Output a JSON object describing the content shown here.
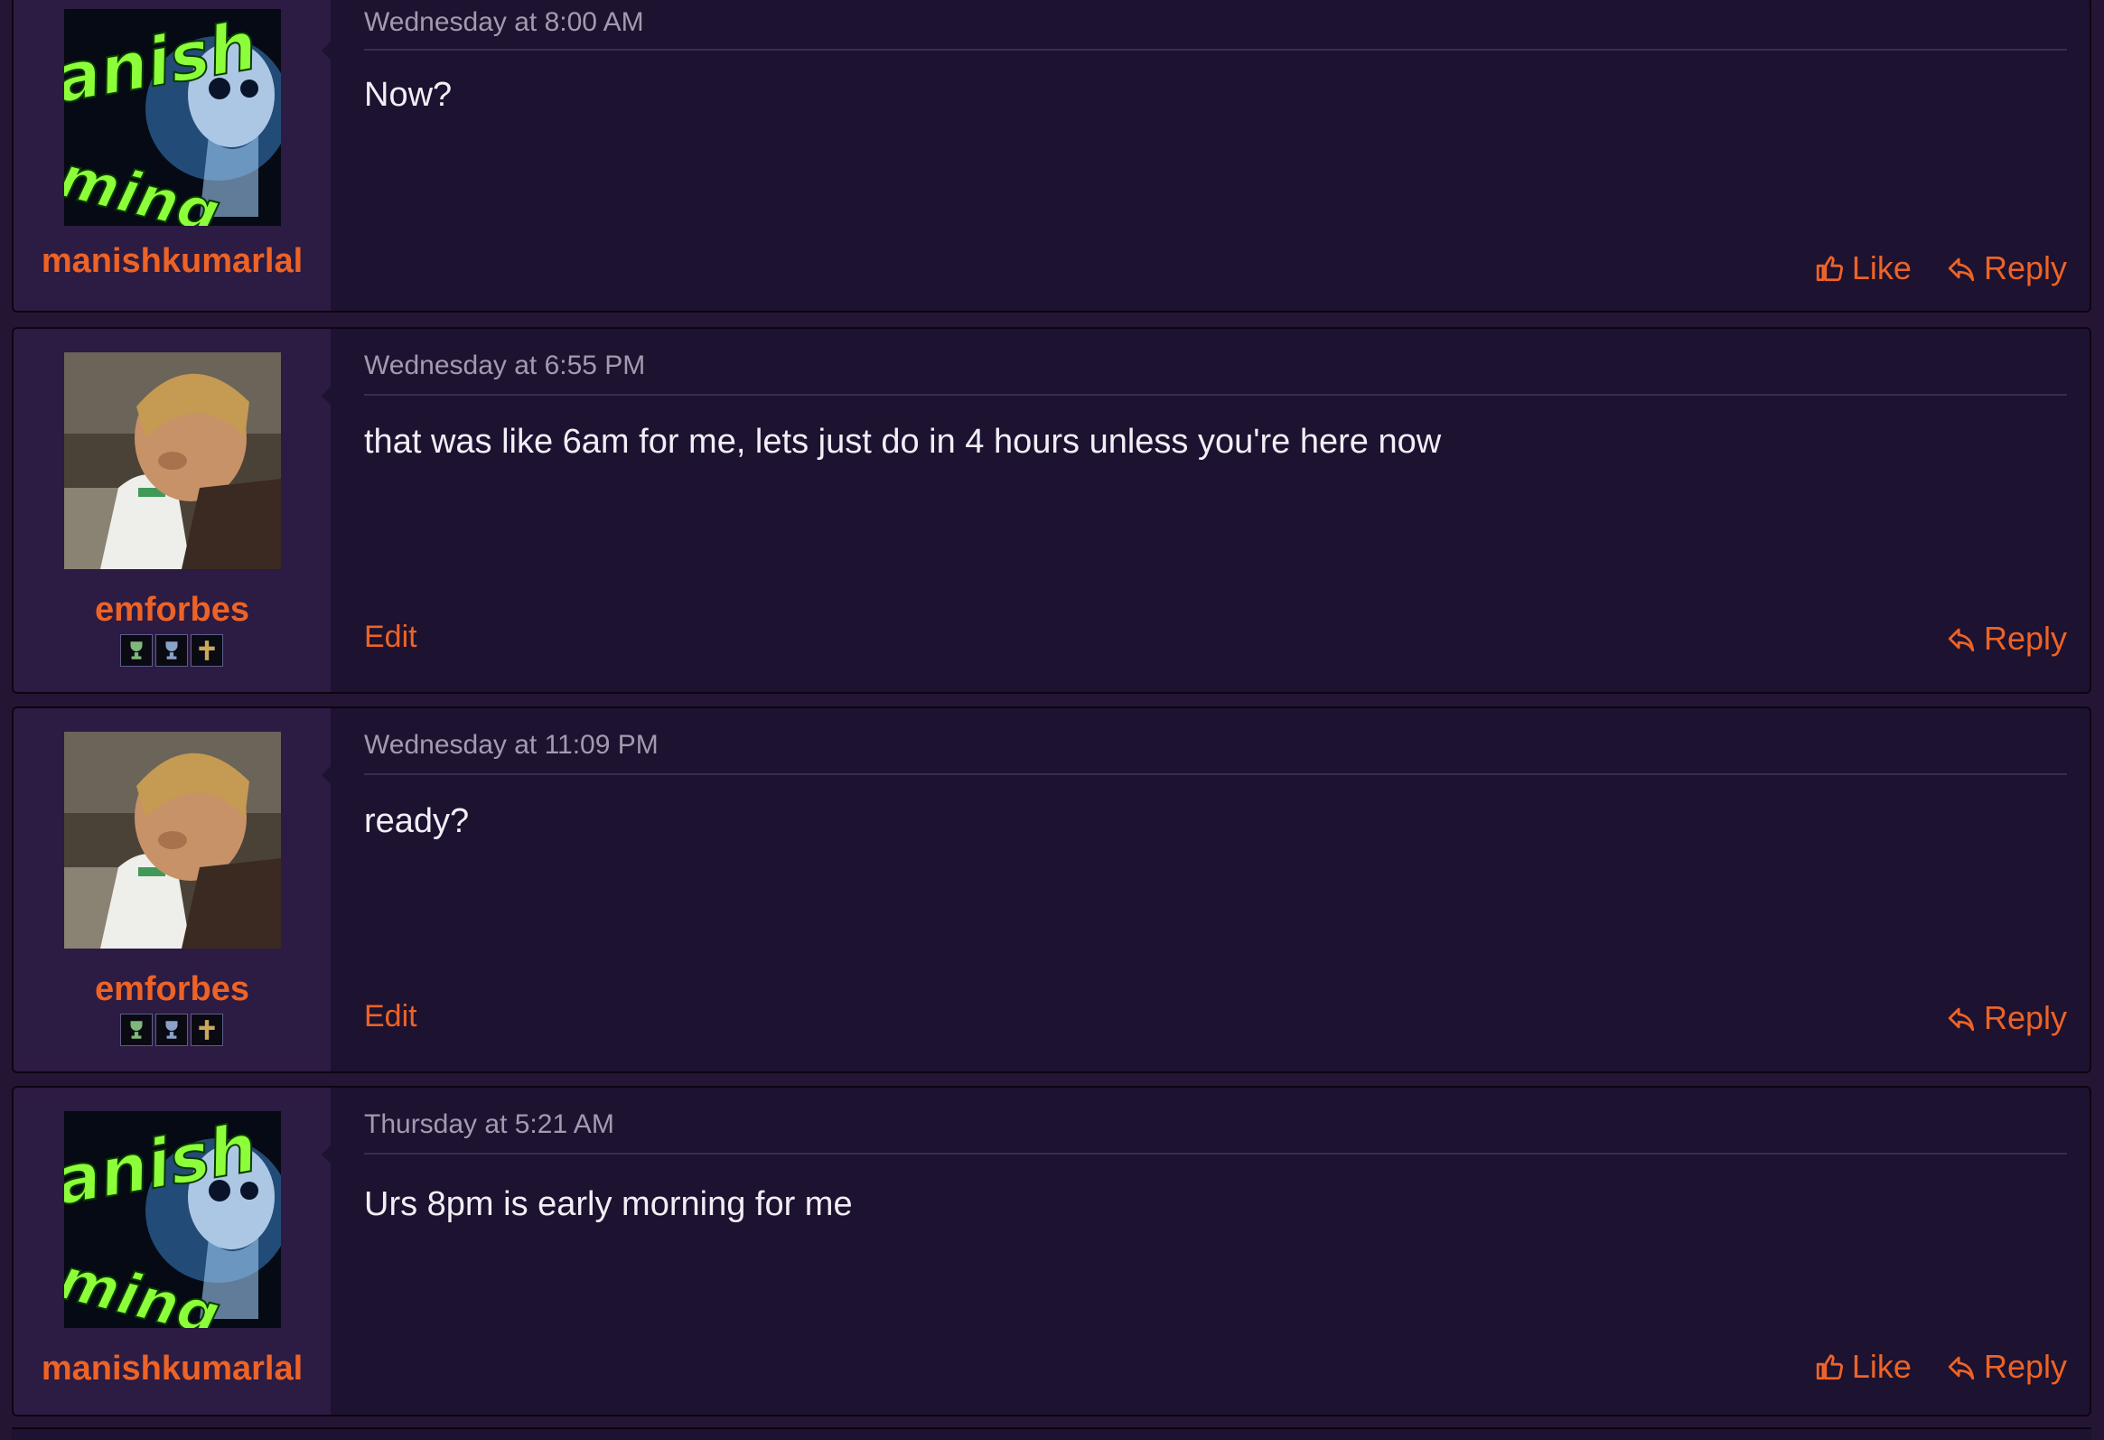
{
  "posts": [
    {
      "username": "manishkumarlal",
      "avatar": "skull-gaming-avatar",
      "timestamp": "Wednesday at 8:00 AM",
      "message": "Now?",
      "like_label": "Like",
      "reply_label": "Reply"
    },
    {
      "username": "emforbes",
      "avatar": "man-with-milk-jug-avatar",
      "timestamp": "Wednesday at 6:55 PM",
      "message": "that was like 6am for me, lets just do in 4 hours unless you're here now",
      "edit_label": "Edit",
      "reply_label": "Reply",
      "badges": [
        "trophy-icon",
        "trophy-icon",
        "cross-icon"
      ]
    },
    {
      "username": "emforbes",
      "avatar": "man-with-milk-jug-avatar",
      "timestamp": "Wednesday at 11:09 PM",
      "message": "ready?",
      "edit_label": "Edit",
      "reply_label": "Reply",
      "badges": [
        "trophy-icon",
        "trophy-icon",
        "cross-icon"
      ]
    },
    {
      "username": "manishkumarlal",
      "avatar": "skull-gaming-avatar",
      "timestamp": "Thursday at 5:21 AM",
      "message": "Urs 8pm is early morning for me",
      "like_label": "Like",
      "reply_label": "Reply"
    }
  ],
  "colors": {
    "accent": "#ed6326",
    "post_bg": "#1d1230",
    "user_bg": "#2c1b42",
    "page_bg": "#251535"
  }
}
